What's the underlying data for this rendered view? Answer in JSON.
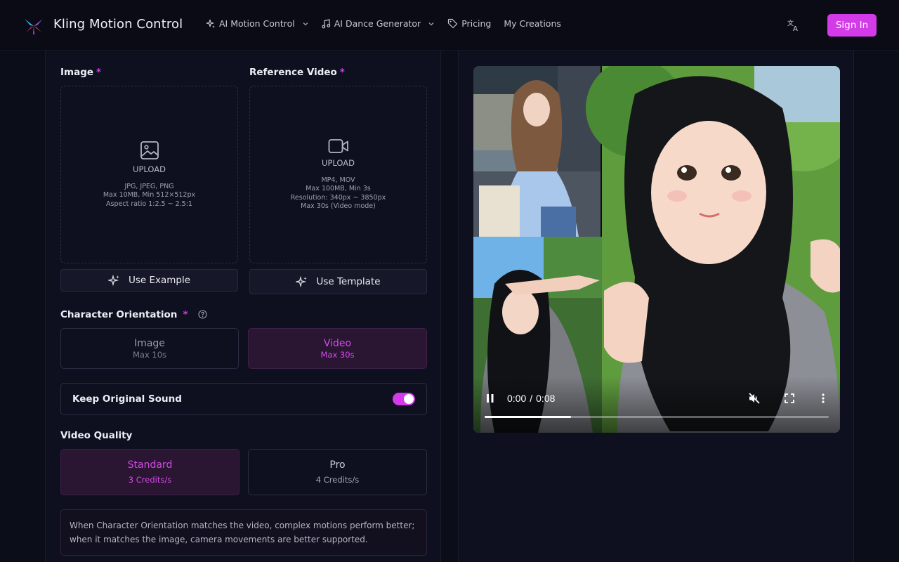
{
  "app": {
    "brand": "Kling Motion Control",
    "accent_color": "#d33be8",
    "logo": "pinwheel-logo"
  },
  "nav": {
    "items": [
      {
        "label": "AI Motion Control",
        "icon": "sparkle-icon",
        "dropdown": true
      },
      {
        "label": "AI Dance Generator",
        "icon": "music-note-icon",
        "dropdown": true
      },
      {
        "label": "Pricing",
        "icon": "tag-icon",
        "dropdown": false
      },
      {
        "label": "My Creations",
        "icon": "",
        "dropdown": false
      }
    ],
    "language_icon": "translate-icon",
    "sign_in_label": "Sign In"
  },
  "form": {
    "image": {
      "label": "Image",
      "required_mark": "*",
      "upload_label": "UPLOAD",
      "hints": [
        "JPG, JPEG, PNG",
        "Max 10MB, Min 512×512px",
        "Aspect ratio 1:2.5 ~ 2.5:1"
      ],
      "button_label": "Use Example"
    },
    "reference_video": {
      "label": "Reference Video",
      "required_mark": "*",
      "upload_label": "UPLOAD",
      "hints": [
        "MP4, MOV",
        "Max 100MB, Min 3s",
        "Resolution: 340px ~ 3850px",
        "Max 30s (Video mode)"
      ],
      "button_label": "Use Template"
    },
    "character_orientation": {
      "label": "Character Orientation",
      "required_mark": "*",
      "options": [
        {
          "title": "Image",
          "sub": "Max 10s",
          "selected": false
        },
        {
          "title": "Video",
          "sub": "Max 30s",
          "selected": true
        }
      ]
    },
    "keep_sound": {
      "label": "Keep Original Sound",
      "enabled": true
    },
    "video_quality": {
      "label": "Video Quality",
      "options": [
        {
          "title": "Standard",
          "sub": "3 Credits/s",
          "selected": true
        },
        {
          "title": "Pro",
          "sub": "4 Credits/s",
          "selected": false
        }
      ]
    },
    "note": "When Character Orientation matches the video, complex motions perform better; when it matches the image, camera movements are better supported."
  },
  "player": {
    "current_time": "0:00",
    "separator": "/",
    "duration": "0:08",
    "progress": 0.25,
    "state": "playing",
    "muted": true
  }
}
